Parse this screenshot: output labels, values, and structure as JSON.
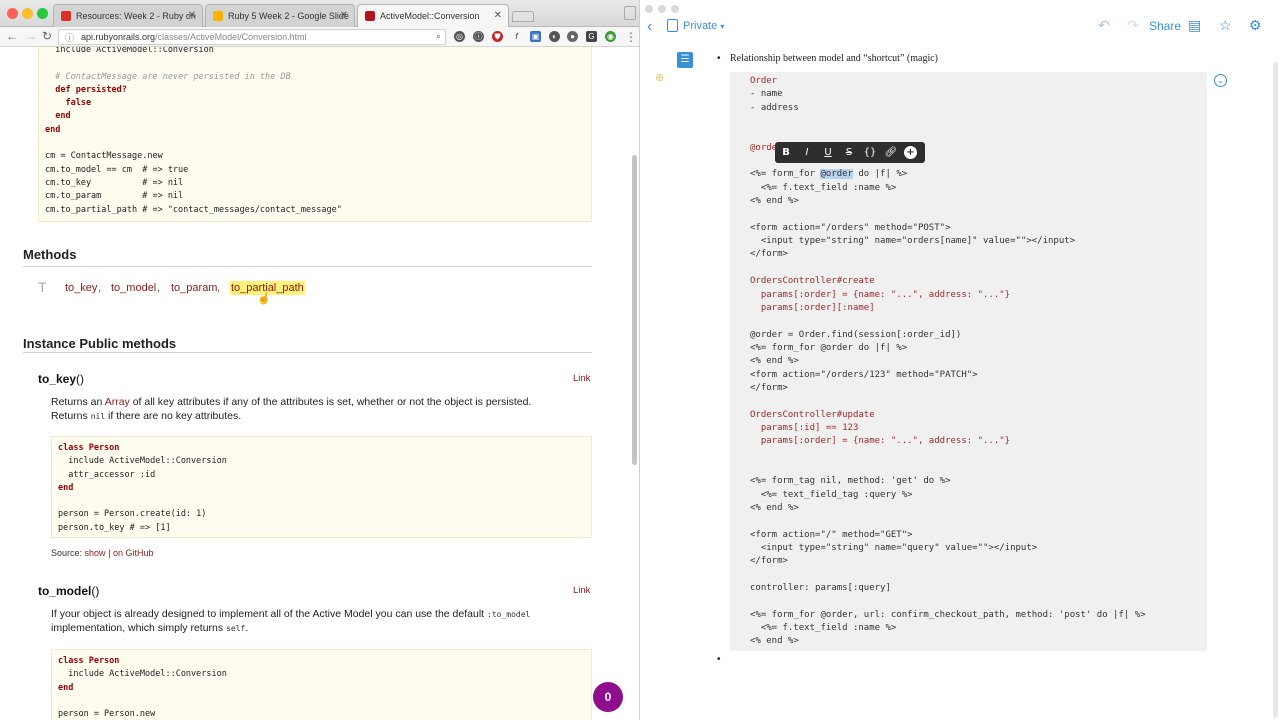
{
  "browser": {
    "tabs": [
      {
        "label": "Resources: Week 2 - Ruby on",
        "favicon_color": "#d93025"
      },
      {
        "label": "Ruby 5 Week 2 - Google Slide",
        "favicon_color": "#f4b400"
      },
      {
        "label": "ActiveModel::Conversion",
        "favicon_color": "#b5161b"
      }
    ],
    "url_host": "api.rubyonrails.org",
    "url_path": "/classes/ActiveModel/Conversion.html"
  },
  "doc": {
    "example_code": [
      "  include ActiveModel::Conversion",
      "",
      "  # ContactMessage are never persisted in the DB",
      "  def persisted?",
      "    false",
      "  end",
      "end",
      "",
      "cm = ContactMessage.new",
      "cm.to_model == cm  # => true",
      "cm.to_key          # => nil",
      "cm.to_param        # => nil",
      "cm.to_partial_path # => \"contact_messages/contact_message\""
    ],
    "methods_heading": "Methods",
    "methods_letter": "T",
    "methods": [
      "to_key",
      "to_model",
      "to_param",
      "to_partial_path"
    ],
    "instance_heading": "Instance Public methods",
    "to_key": {
      "name": "to_key",
      "parens": "()",
      "link": "Link",
      "desc_1": "Returns an ",
      "desc_array": "Array",
      "desc_2": " of all key attributes if any of the attributes is set, whether or not the object is persisted.",
      "desc_3": "Returns ",
      "desc_nil": "nil",
      "desc_4": " if there are no key attributes.",
      "code": [
        "class Person",
        "  include ActiveModel::Conversion",
        "  attr_accessor :id",
        "end",
        "",
        "person = Person.create(id: 1)",
        "person.to_key # => [1]"
      ],
      "source_label": "Source:",
      "source_show": "show",
      "source_sep": "|",
      "source_github": "on GitHub"
    },
    "to_model": {
      "name": "to_model",
      "parens": "()",
      "link": "Link",
      "desc_1": "If your object is already designed to implement all of the Active Model you can use the default ",
      "desc_code": ":to_model",
      "desc_2": "implementation, which simply returns ",
      "desc_self": "self",
      "desc_3": ".",
      "code": [
        "class Person",
        "  include ActiveModel::Conversion",
        "end",
        "",
        "person = Person.new"
      ]
    },
    "badge_count": "0"
  },
  "notes": {
    "back_icon": "chevron-left",
    "privacy": "Private",
    "share": "Share",
    "bullet": "Relationship between model and “shortcut” (magic)",
    "format_buttons": [
      "B",
      "I",
      "U",
      "S",
      "{}",
      "link",
      "+"
    ],
    "code_lines": [
      "Order",
      "- name",
      "- address",
      "",
      "",
      "@order",
      "",
      "<%= form_for @order do |f| %>",
      "  <%= f.text_field :name %>",
      "<% end %>",
      "",
      "<form action=\"/orders\" method=\"POST\">",
      "  <input type=\"string\" name=\"orders[name]\" value=\"\"></input>",
      "</form>",
      "",
      "OrdersController#create",
      "  params[:order] = {name: \"...\", address: \"...\"}",
      "  params[:order][:name]",
      "",
      "@order = Order.find(session[:order_id])",
      "<%= form_for @order do |f| %>",
      "<% end %>",
      "<form action=\"/orders/123\" method=\"PATCH\">",
      "</form>",
      "",
      "OrdersController#update",
      "  params[:id] == 123",
      "  params[:order] = {name: \"...\", address: \"...\"}",
      "",
      "",
      "<%= form_tag nil, method: 'get' do %>",
      "  <%= text_field_tag :query %>",
      "<% end %>",
      "",
      "<form action=\"/\" method=\"GET\">",
      "  <input type=\"string\" name=\"query\" value=\"\"></input>",
      "</form>",
      "",
      "controller: params[:query]",
      "",
      "<%= form_for @order, url: confirm_checkout_path, method: 'post' do |f| %>",
      "  <%= f.text_field :name %>",
      "<% end %>"
    ]
  }
}
